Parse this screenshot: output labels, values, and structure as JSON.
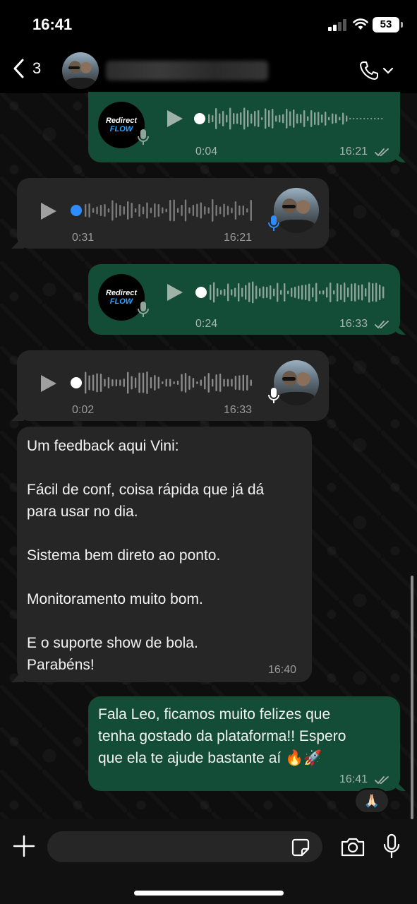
{
  "status_bar": {
    "time": "16:41",
    "battery": "53"
  },
  "header": {
    "back_count": "3",
    "contact_name": ""
  },
  "voice_brand": {
    "line1": "Redirect",
    "line2": "FLOW"
  },
  "messages": [
    {
      "type": "voice",
      "direction": "outgoing",
      "duration": "0:04",
      "time": "16:21",
      "status": "read"
    },
    {
      "type": "voice",
      "direction": "incoming",
      "duration": "0:31",
      "time": "16:21"
    },
    {
      "type": "voice",
      "direction": "outgoing",
      "duration": "0:24",
      "time": "16:33",
      "status": "read"
    },
    {
      "type": "voice",
      "direction": "incoming",
      "duration": "0:02",
      "time": "16:33"
    },
    {
      "type": "text",
      "direction": "incoming",
      "text": "Um feedback aqui Vini:\n\nFácil de conf, coisa rápida que já dá\npara usar no dia.\n\nSistema bem direto ao ponto.\n\nMonitoramento muito bom.\n\nE o suporte show de bola.\nParabéns!",
      "time": "16:40"
    },
    {
      "type": "text",
      "direction": "outgoing",
      "text": "Fala Leo, ficamos muito felizes que\ntenha gostado da plataforma!! Espero\nque ela te ajude bastante aí 🔥🚀",
      "time": "16:41",
      "status": "read",
      "reaction": "🙏🏻"
    }
  ],
  "composer": {
    "placeholder": ""
  },
  "colors": {
    "outgoing_bubble": "#144d37",
    "incoming_bubble": "#262626",
    "accent_blue": "#2f8cff"
  }
}
